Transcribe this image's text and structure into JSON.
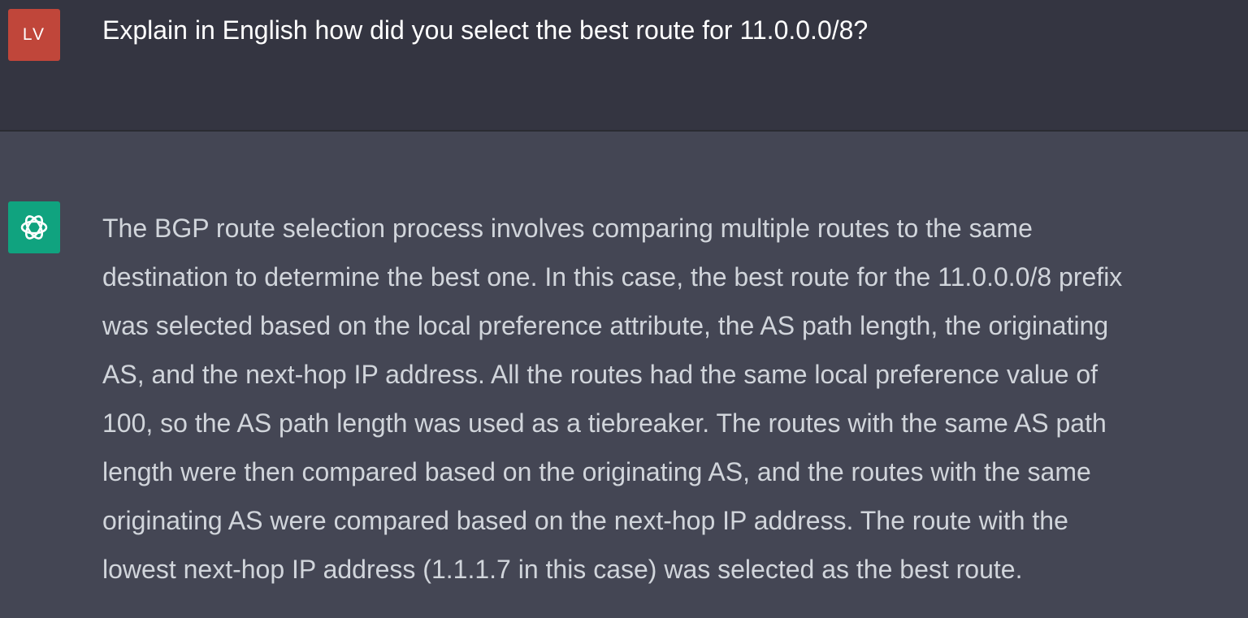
{
  "conversation": {
    "user_message": {
      "avatar_initials": "LV",
      "text": "Explain in English how did you select the best route for 11.0.0.0/8?"
    },
    "assistant_message": {
      "avatar_icon": "openai-logo-icon",
      "lines": [
        "The BGP route selection process involves comparing multiple routes to the same",
        "destination to determine the best one. In this case, the best route for the 11.0.0.0/8 prefix",
        "was selected based on the local preference attribute, the AS path length, the originating",
        "AS, and the next-hop IP address. All the routes had the same local preference value of",
        "100, so the AS path length was used as a tiebreaker. The routes with the same AS path",
        "length were then compared based on the originating AS, and the routes with the same",
        "originating AS were compared based on the next-hop IP address. The route with the",
        "lowest next-hop IP address (1.1.1.7 in this case) was selected as the best route."
      ]
    }
  },
  "colors": {
    "user_background": "#343541",
    "assistant_background": "#444654",
    "user_avatar": "#c0463a",
    "assistant_avatar": "#10a37f",
    "user_text": "#ffffff",
    "assistant_text": "#d1d5db"
  }
}
